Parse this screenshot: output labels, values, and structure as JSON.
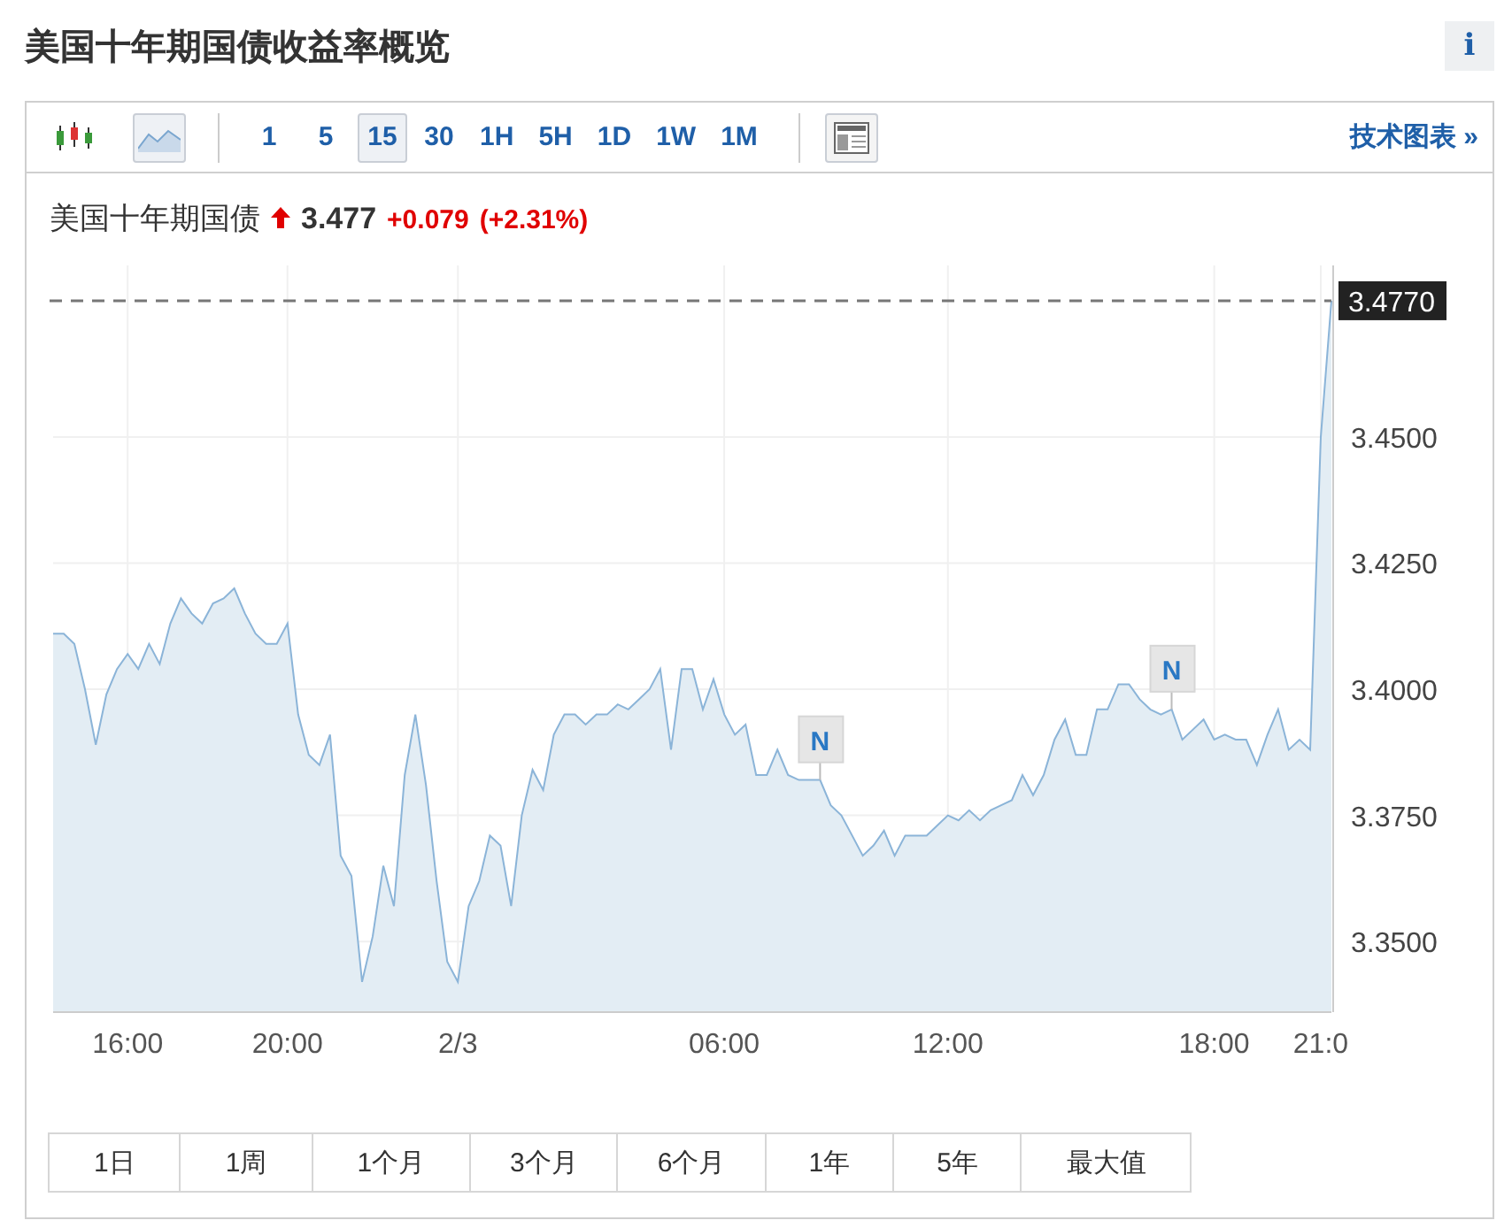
{
  "title": "美国十年期国债收益率概览",
  "info_button": "i",
  "toolbar": {
    "chart_types": [
      {
        "kind": "candle",
        "selected": false
      },
      {
        "kind": "area",
        "selected": true
      }
    ],
    "intervals": [
      {
        "label": "1",
        "selected": false
      },
      {
        "label": "5",
        "selected": false
      },
      {
        "label": "15",
        "selected": true
      },
      {
        "label": "30",
        "selected": false
      },
      {
        "label": "1H",
        "selected": false
      },
      {
        "label": "5H",
        "selected": false
      },
      {
        "label": "1D",
        "selected": false
      },
      {
        "label": "1W",
        "selected": false
      },
      {
        "label": "1M",
        "selected": false
      }
    ],
    "tech_link": "技术图表 »"
  },
  "quote": {
    "name": "美国十年期国债",
    "up": true,
    "price": "3.477",
    "change": "+0.079",
    "change_pct": "(+2.31%)"
  },
  "chart_data": {
    "type": "area",
    "ylim": [
      3.336,
      3.484
    ],
    "grid": true,
    "categories": [
      null,
      null,
      null,
      null,
      null,
      null,
      null,
      "16:00",
      null,
      null,
      null,
      null,
      null,
      null,
      null,
      null,
      null,
      null,
      null,
      null,
      null,
      null,
      "20:00",
      null,
      null,
      null,
      null,
      null,
      null,
      null,
      null,
      null,
      null,
      null,
      null,
      null,
      null,
      null,
      "2/3",
      null,
      null,
      null,
      null,
      null,
      null,
      null,
      null,
      null,
      null,
      null,
      null,
      null,
      null,
      null,
      null,
      null,
      null,
      null,
      null,
      null,
      null,
      null,
      null,
      "06:00",
      null,
      null,
      null,
      null,
      null,
      null,
      null,
      null,
      null,
      null,
      null,
      null,
      null,
      null,
      null,
      null,
      null,
      null,
      null,
      null,
      "12:00",
      null,
      null,
      null,
      null,
      null,
      null,
      null,
      null,
      null,
      null,
      null,
      null,
      null,
      null,
      null,
      null,
      null,
      null,
      null,
      null,
      null,
      null,
      null,
      null,
      "18:00",
      null,
      null,
      null,
      null,
      null,
      null,
      null,
      null,
      null,
      "21:0",
      null
    ],
    "yticks": [
      {
        "value": 3.35,
        "label": "3.3500"
      },
      {
        "value": 3.375,
        "label": "3.3750"
      },
      {
        "value": 3.4,
        "label": "3.4000"
      },
      {
        "value": 3.425,
        "label": "3.4250"
      },
      {
        "value": 3.45,
        "label": "3.4500"
      }
    ],
    "values": [
      3.411,
      3.411,
      3.409,
      3.4,
      3.389,
      3.399,
      3.404,
      3.407,
      3.404,
      3.409,
      3.405,
      3.413,
      3.418,
      3.415,
      3.413,
      3.417,
      3.418,
      3.42,
      3.415,
      3.411,
      3.409,
      3.409,
      3.413,
      3.395,
      3.387,
      3.385,
      3.391,
      3.367,
      3.363,
      3.342,
      3.351,
      3.365,
      3.357,
      3.383,
      3.395,
      3.381,
      3.362,
      3.346,
      3.342,
      3.357,
      3.362,
      3.371,
      3.369,
      3.357,
      3.375,
      3.384,
      3.38,
      3.391,
      3.395,
      3.395,
      3.393,
      3.395,
      3.395,
      3.397,
      3.396,
      3.398,
      3.4,
      3.404,
      3.388,
      3.404,
      3.404,
      3.396,
      3.402,
      3.395,
      3.391,
      3.393,
      3.383,
      3.383,
      3.388,
      3.383,
      3.382,
      3.382,
      3.382,
      3.377,
      3.375,
      3.371,
      3.367,
      3.369,
      3.372,
      3.367,
      3.371,
      3.371,
      3.371,
      3.373,
      3.375,
      3.374,
      3.376,
      3.374,
      3.376,
      3.377,
      3.378,
      3.383,
      3.379,
      3.383,
      3.39,
      3.394,
      3.387,
      3.387,
      3.396,
      3.396,
      3.401,
      3.401,
      3.398,
      3.396,
      3.395,
      3.396,
      3.39,
      3.392,
      3.394,
      3.39,
      3.391,
      3.39,
      3.39,
      3.385,
      3.391,
      3.396,
      3.388,
      3.39,
      3.388,
      3.45,
      3.477
    ],
    "ref_lines": [
      {
        "axis": "y",
        "value": 3.477,
        "label": "3.4770"
      }
    ],
    "annotations": [
      {
        "text": "N",
        "y": 3.382
      },
      {
        "text": "N",
        "y": 3.396
      }
    ]
  },
  "ranges": [
    {
      "label": "1日",
      "selected": false
    },
    {
      "label": "1周",
      "selected": false
    },
    {
      "label": "1个月",
      "selected": false
    },
    {
      "label": "3个月",
      "selected": false
    },
    {
      "label": "6个月",
      "selected": false
    },
    {
      "label": "1年",
      "selected": false
    },
    {
      "label": "5年",
      "selected": false
    },
    {
      "label": "最大值",
      "selected": false
    }
  ]
}
